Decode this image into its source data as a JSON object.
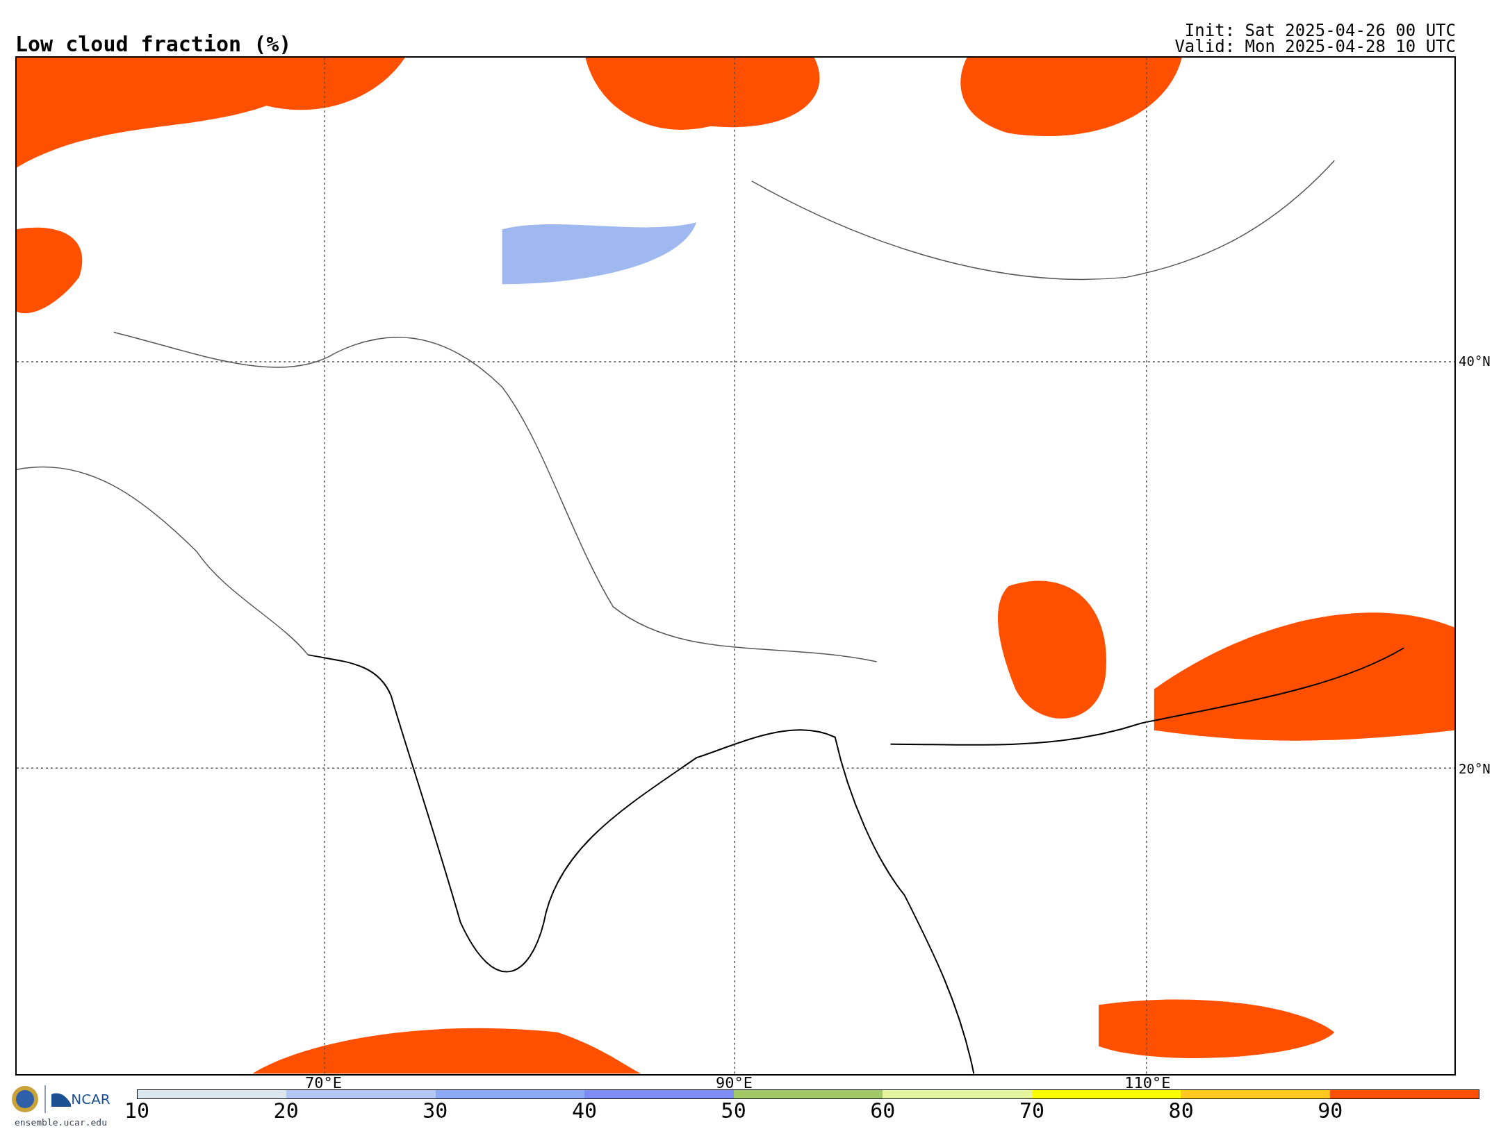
{
  "title": "Low cloud fraction (%)",
  "init": "Init: Sat 2025-04-26 00 UTC",
  "valid": "Valid: Mon 2025-04-28 10 UTC",
  "map": {
    "lat_labels": [
      "40°N",
      "20°N"
    ],
    "lon_labels": [
      "70°E",
      "90°E",
      "110°E"
    ]
  },
  "logo": {
    "name": "NCAR",
    "url": "ensemble.ucar.edu"
  },
  "colorbar": {
    "segments": [
      {
        "color": "#dce6ee"
      },
      {
        "color": "#b4c8f5"
      },
      {
        "color": "#8caaf5"
      },
      {
        "color": "#7d8cf5"
      },
      {
        "color": "#a0c864"
      },
      {
        "color": "#e6f5a0"
      },
      {
        "color": "#ffff00"
      },
      {
        "color": "#ffc81e"
      },
      {
        "color": "#ff5000"
      }
    ],
    "ticks": [
      "10",
      "20",
      "30",
      "40",
      "50",
      "60",
      "70",
      "80",
      "90"
    ]
  }
}
